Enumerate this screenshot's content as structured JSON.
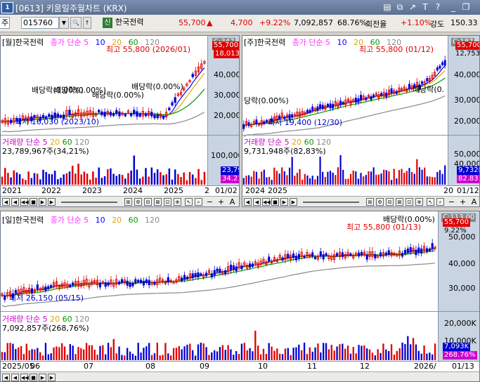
{
  "window": {
    "title": "[0613] 키움일주월차트 (KRX)",
    "app_icon": "1"
  },
  "toolbar": {
    "market": "주",
    "code": "015760",
    "badge": "신",
    "name": "한국전력",
    "price": "55,700",
    "change_arrow": "▲",
    "change": "4,700",
    "change_pct": "+9.22%",
    "volume": "7,092,857",
    "ratio": "68.76%",
    "turnover_label": "회전율",
    "turnover": "+1.10%",
    "strength_label": "강도",
    "strength": "150.33"
  },
  "colors": {
    "up": "#e00000",
    "down": "#0000d0",
    "ma5": "#ff33ff",
    "ma10": "#0000ff",
    "ma20": "#e6a500",
    "ma60": "#009900",
    "ma120": "#888888"
  },
  "panes": {
    "monthly": {
      "title": "[월]한국전력",
      "legend": [
        "종가 단순 5",
        "10",
        "20",
        "60",
        "120"
      ],
      "price_tag": "55,700",
      "price_tag2": "18,013",
      "top_tag": "C:347",
      "high_label": "최고 55,800 (2026/01)",
      "low_label": "최저 16,030 (2023/10)",
      "ann": [
        "배당락(0.00%)",
        "배당락(0.00%)",
        "배당락(0.00%)",
        "배당락(0.00%)"
      ],
      "yticks": [
        "40,000",
        "30,000",
        "20,000"
      ],
      "vol_title": "거래량 단순 5 20 60 120",
      "vol_value": "23,789,967주(34,21%)",
      "vol_ytick": "100,000",
      "vol_tag": "23,790",
      "vol_tag2": "34.21",
      "xticks": [
        "2021",
        "2022",
        "2023",
        "2024",
        "2025",
        "2"
      ],
      "date": "01/02"
    },
    "weekly": {
      "title": "[주]한국전력",
      "legend": [
        "종가 단순 5",
        "10",
        "20",
        "60",
        "120"
      ],
      "price_tag": "55,700",
      "top_tag": "C:187",
      "price_tag2": "12,753",
      "high_label": "최고 55,800 (01/12)",
      "low_label": "최저 19,400 (12/30)",
      "ann": [
        "당락(0.00%)",
        "배당락(0."
      ],
      "yticks": [
        "40,000",
        "30,000",
        "20,000"
      ],
      "vol_title": "거래량 단순 5 20 60 120",
      "vol_value": "9,731,948주(82,83%)",
      "vol_yticks": [
        "50,000",
        "40,000"
      ],
      "vol_tag": "9,732K",
      "vol_tag2": "82.83",
      "xticks": [
        "2024",
        "2025",
        "20"
      ],
      "date": "01/12"
    },
    "daily": {
      "title": "[일]한국전력",
      "legend": [
        "종가 단순 5",
        "10",
        "20",
        "60",
        "120"
      ],
      "price_tag": "55,700",
      "top_tag": "C:113.00",
      "pct_tag": "9.22%",
      "high_label": "최고 55,800 (01/13)",
      "low_label": "최저 26,150 (05/15)",
      "ann": [
        "배당락(0.00%)"
      ],
      "yticks": [
        "50,000",
        "40,000",
        "30,000"
      ],
      "vol_title": "거래량 단순 5 20 60 120",
      "vol_value": "7,092,857주(268,76%)",
      "vol_ytick": "20,000K",
      "vol_ytick2": "10,000K",
      "vol_tag": "7,093K",
      "vol_tag2": "268.76%",
      "xticks": [
        "2025/05",
        "06",
        "07",
        "08",
        "09",
        "10",
        "11",
        "12",
        "2026/"
      ],
      "date": "01/13"
    }
  },
  "icons": {
    "search": "search-icon",
    "zoom_in": "zoom-in-icon",
    "zoom_out": "zoom-out-icon",
    "first": "first-icon",
    "prev": "prev-icon",
    "stop": "stop-icon",
    "next": "next-icon",
    "last": "last-icon"
  }
}
